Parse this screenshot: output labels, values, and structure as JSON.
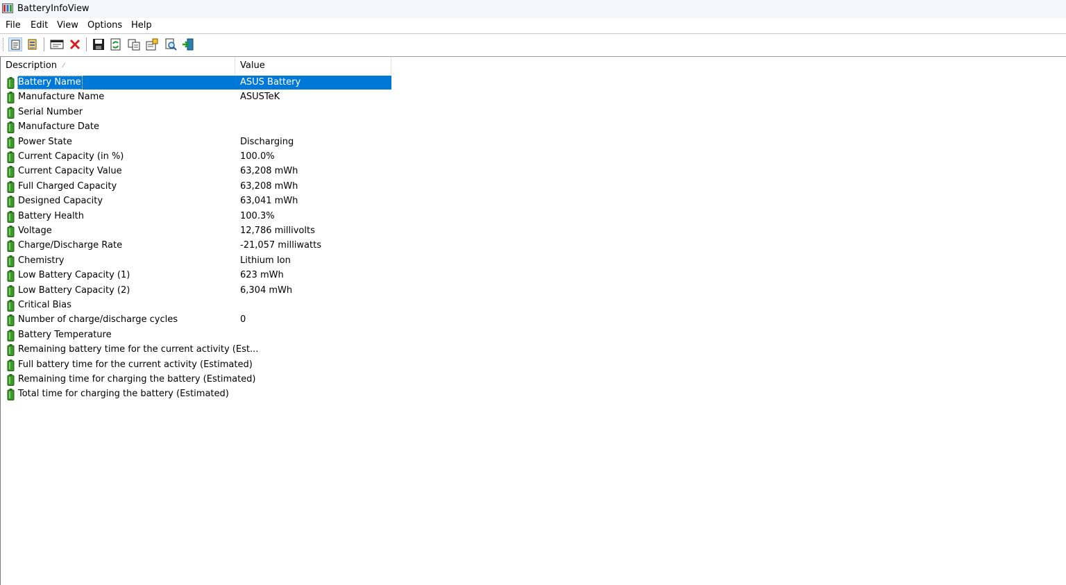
{
  "window": {
    "title": "BatteryInfoView"
  },
  "menu": [
    "File",
    "Edit",
    "View",
    "Options",
    "Help"
  ],
  "toolbar": [
    {
      "icon": "properties-view-icon",
      "pressed": true
    },
    {
      "icon": "battery-log-icon",
      "pressed": false
    },
    {
      "icon": "html-report-icon",
      "pressed": false
    },
    {
      "icon": "delete-icon",
      "pressed": false
    },
    {
      "icon": "save-icon",
      "pressed": false
    },
    {
      "icon": "refresh-icon",
      "pressed": false
    },
    {
      "icon": "copy-icon",
      "pressed": false
    },
    {
      "icon": "properties-icon",
      "pressed": false
    },
    {
      "icon": "find-icon",
      "pressed": false
    },
    {
      "icon": "exit-icon",
      "pressed": false
    }
  ],
  "columns": {
    "description": "Description",
    "value": "Value"
  },
  "rows": [
    {
      "description": "Battery Name",
      "value": "ASUS Battery",
      "selected": true
    },
    {
      "description": "Manufacture Name",
      "value": "ASUSTeK"
    },
    {
      "description": "Serial Number",
      "value": ""
    },
    {
      "description": "Manufacture Date",
      "value": ""
    },
    {
      "description": "Power State",
      "value": "Discharging"
    },
    {
      "description": "Current Capacity (in %)",
      "value": "100.0%"
    },
    {
      "description": "Current Capacity Value",
      "value": "63,208 mWh"
    },
    {
      "description": "Full Charged Capacity",
      "value": "63,208 mWh"
    },
    {
      "description": "Designed Capacity",
      "value": "63,041 mWh"
    },
    {
      "description": "Battery Health",
      "value": "100.3%"
    },
    {
      "description": "Voltage",
      "value": "12,786 millivolts"
    },
    {
      "description": "Charge/Discharge Rate",
      "value": "-21,057 milliwatts"
    },
    {
      "description": "Chemistry",
      "value": "Lithium Ion"
    },
    {
      "description": "Low Battery Capacity (1)",
      "value": "623 mWh"
    },
    {
      "description": "Low Battery Capacity (2)",
      "value": "6,304 mWh"
    },
    {
      "description": "Critical Bias",
      "value": ""
    },
    {
      "description": "Number of charge/discharge cycles",
      "value": "0"
    },
    {
      "description": "Battery Temperature",
      "value": ""
    },
    {
      "description": "Remaining battery time for the current activity (Est...",
      "value": ""
    },
    {
      "description": "Full battery time for the current activity (Estimated)",
      "value": ""
    },
    {
      "description": "Remaining time for charging the battery (Estimated)",
      "value": ""
    },
    {
      "description": "Total  time for charging the battery (Estimated)",
      "value": ""
    }
  ],
  "colors": {
    "selection": "#0078d7",
    "battery_green": "#3c9a2a"
  }
}
